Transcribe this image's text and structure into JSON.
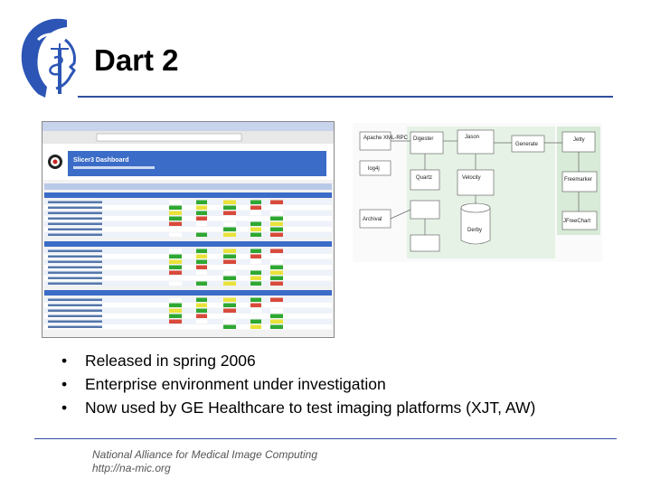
{
  "slide": {
    "title": "Dart 2",
    "bullets": [
      "Released in spring 2006",
      "Enterprise environment under investigation",
      "Now used by GE Healthcare to test imaging platforms (XJT, AW)"
    ],
    "footer": {
      "line1": "National Alliance for Medical Image Computing",
      "line2": "http://na-mic.org"
    }
  },
  "dashboard_screenshot": {
    "header_title": "Slicer3 Dashboard",
    "section_labels": [
      "Nightly",
      "Continuous",
      "Experimental"
    ]
  },
  "architecture_diagram": {
    "boxes": [
      "Apache XML-RPC",
      "Digester",
      "Jason",
      "Generate",
      "Jetty",
      "log4j",
      "Quartz",
      "Velocity",
      "Freemarker",
      "Archival",
      "Derby",
      "JFreeChart"
    ]
  }
}
